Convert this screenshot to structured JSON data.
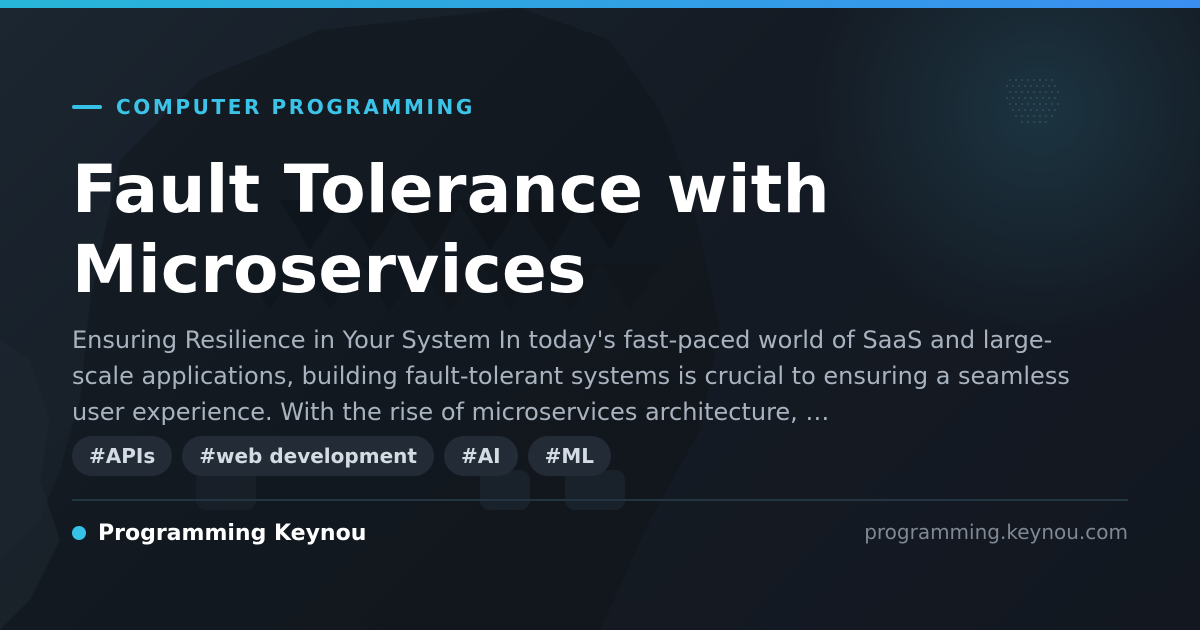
{
  "post": {
    "category": "COMPUTER PROGRAMMING",
    "title": "Fault Tolerance with Microservices",
    "excerpt": "Ensuring Resilience in Your System In today's fast-paced world of SaaS and large-scale applications, building fault-tolerant systems is crucial to ensuring a seamless user experience. With the rise of microservices architecture, …",
    "tags": [
      "#APIs",
      "#web development",
      "#AI",
      "#ML"
    ]
  },
  "footer": {
    "brand": "Programming Keynou",
    "domain": "programming.keynou.com"
  },
  "colors": {
    "accent": "#36c2e6",
    "background": "#161c24",
    "title": "#ffffff",
    "excerpt": "#a9b3bf",
    "tag_background": "#232c36",
    "domain": "#7f8893"
  }
}
